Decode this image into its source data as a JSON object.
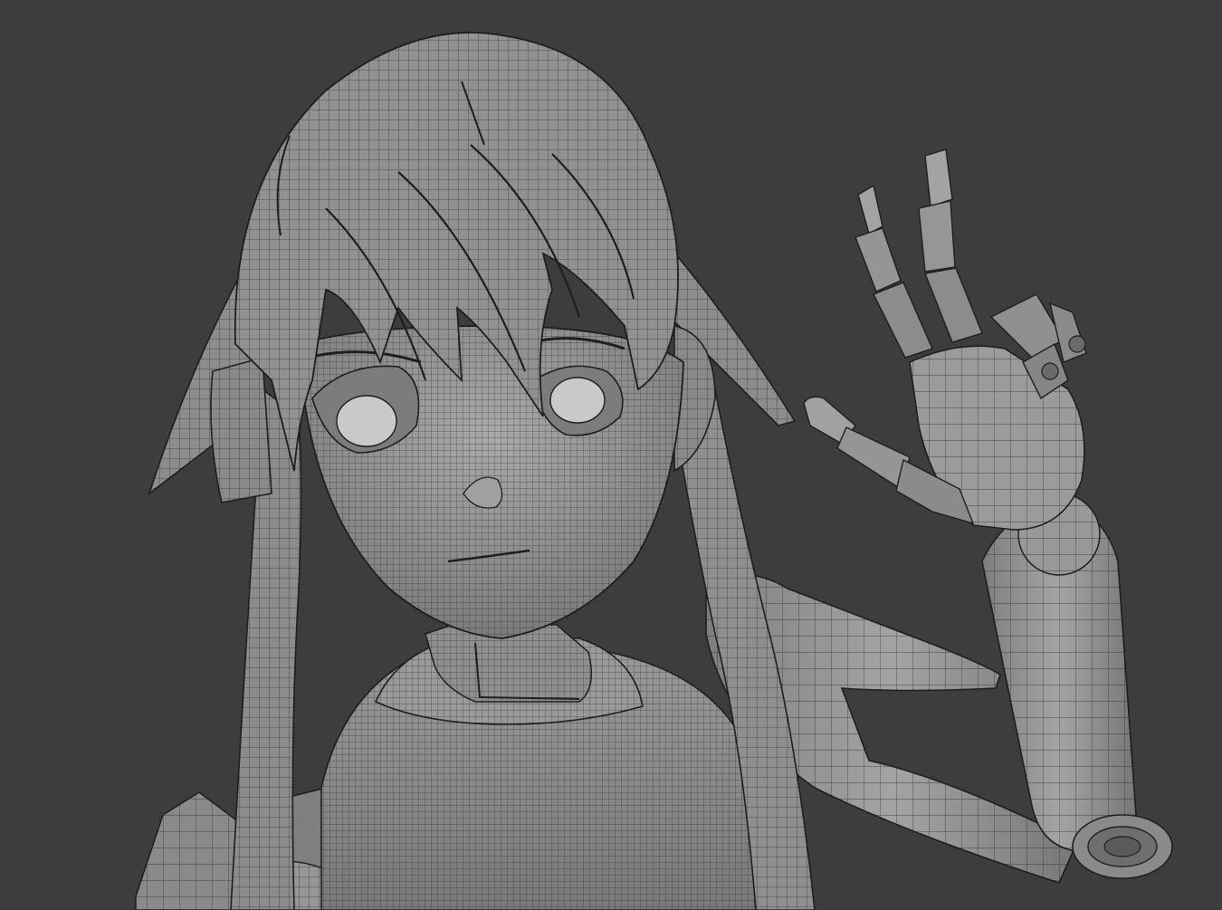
{
  "viewport": {
    "background": "#3d3d3d",
    "mesh_fill": "#8e8e8e",
    "mesh_shadow": "#5e5e5e",
    "mesh_highlight": "#b4b4b4",
    "wire_color": "#1e1e1e",
    "eye_fill": "#c9c9c9",
    "shading_mode": "solid-wireframe",
    "subject": "stylized-character-mesh"
  }
}
